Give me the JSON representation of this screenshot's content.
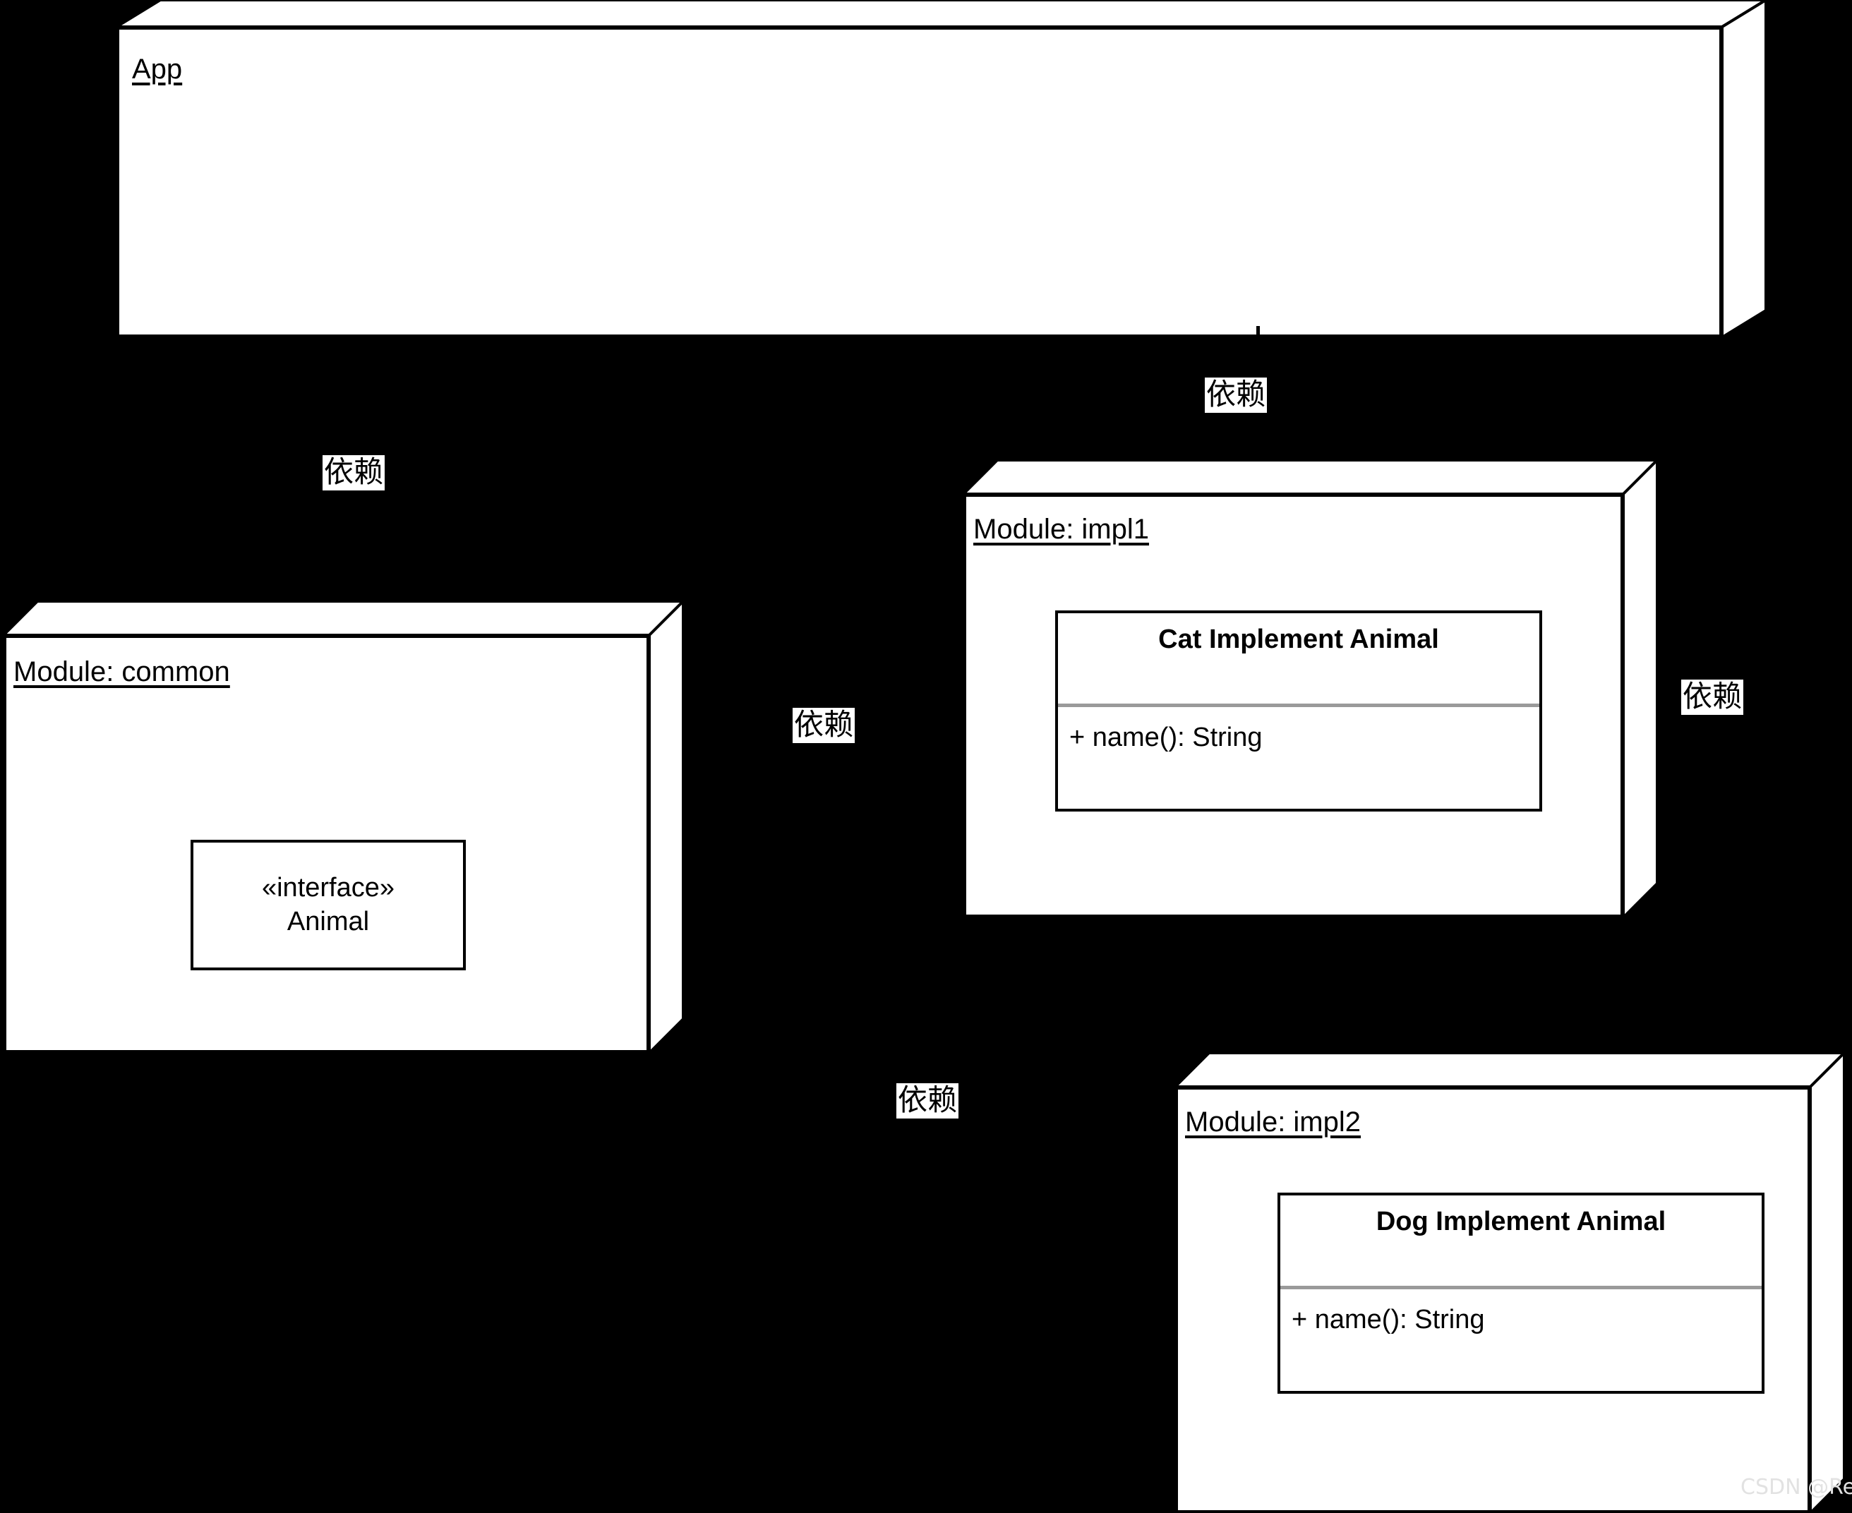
{
  "diagram": {
    "type": "uml-component-deployment",
    "background_color": "#000000",
    "node_fill_color": "#ffffff",
    "stroke_color": "#000000",
    "separator_color": "#9a9a9a"
  },
  "nodes": {
    "app": {
      "title": "App"
    },
    "common": {
      "title": "Module: common",
      "interface": {
        "stereotype": "«interface»",
        "name": "Animal"
      }
    },
    "impl1": {
      "title": "Module: impl1",
      "class": {
        "title": "Cat Implement Animal",
        "members": [
          "+ name(): String"
        ]
      }
    },
    "impl2": {
      "title": "Module: impl2",
      "class": {
        "title": "Dog Implement Animal",
        "members": [
          "+ name(): String"
        ]
      }
    }
  },
  "dependency_labels": [
    {
      "id": "dep-app-impl1",
      "text": "依赖"
    },
    {
      "id": "dep-app-common",
      "text": "依赖"
    },
    {
      "id": "dep-impl1-common",
      "text": "依赖"
    },
    {
      "id": "dep-app-impl2",
      "text": "依赖"
    },
    {
      "id": "dep-impl2-right",
      "text": "依赖"
    }
  ],
  "watermark": {
    "text": "CSDN @Reven_L"
  }
}
